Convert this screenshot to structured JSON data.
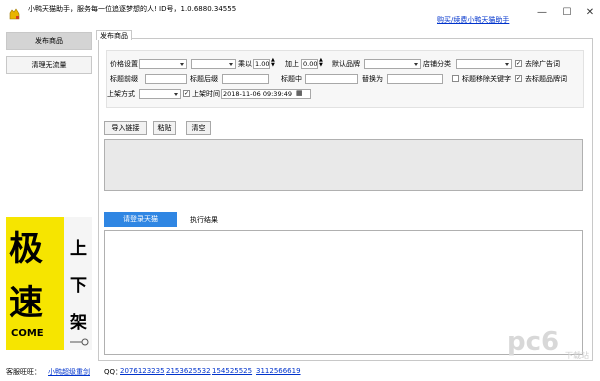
{
  "window": {
    "title": "小鸭天猫助手，服务每一位追逐梦想的人! ID号，1.0.6880.34555",
    "link": "购买/续费小鸭天猫助手",
    "min_glyph": "—",
    "max_glyph": "☐",
    "close_glyph": "✕"
  },
  "sidebar": {
    "items": [
      {
        "label": "发布商品"
      },
      {
        "label": "清理无流量"
      }
    ]
  },
  "ad": {
    "big1": "极",
    "big2": "速",
    "side1": "上",
    "side2": "下",
    "side3": "架",
    "come": "COME"
  },
  "tab": {
    "label": "发布商品"
  },
  "form": {
    "price_label": "价格设置",
    "price_select1": "",
    "price_select2": "",
    "multiply_label": "乘以",
    "multiply_value": "1.00",
    "add_label": "加上",
    "add_value": "0.00",
    "brand_label": "默认品牌",
    "brand_value": "",
    "shop_cat_label": "店铺分类",
    "shop_cat_value": "",
    "remove_ad_label": "去除广告词",
    "remove_ad_checked": true,
    "prefix_label": "标题前缀",
    "prefix_value": "",
    "suffix_label": "标题后缀",
    "suffix_value": "",
    "middle_label": "标题中",
    "middle_value": "",
    "replace_label": "替换为",
    "replace_value": "",
    "move_kw_label": "标题移除关键字",
    "move_kw_checked": false,
    "remove_brand_label": "去标题品牌词",
    "remove_brand_checked": true,
    "method_label": "上架方式",
    "method_value": "",
    "time_label": "上架时间",
    "time_checked": true,
    "time_value": "2018-11-06 09:39:49"
  },
  "buttons": {
    "import": "导入链接",
    "paste": "粘贴",
    "clear": "清空",
    "login": "请登录天猫",
    "result": "执行结果"
  },
  "footer": {
    "shop_label": "客服旺旺：",
    "shop_link": "小鸭超级重剑",
    "qq_label": "QQ：",
    "qq": [
      "2076123235",
      "2153625532",
      "154525525",
      "3112566619"
    ]
  },
  "watermark": {
    "text": "pc6",
    "sub": "下载站"
  },
  "colors": {
    "login_button": "#2f86e3",
    "link": "#0033cc",
    "ad_yellow": "#f6e500"
  }
}
